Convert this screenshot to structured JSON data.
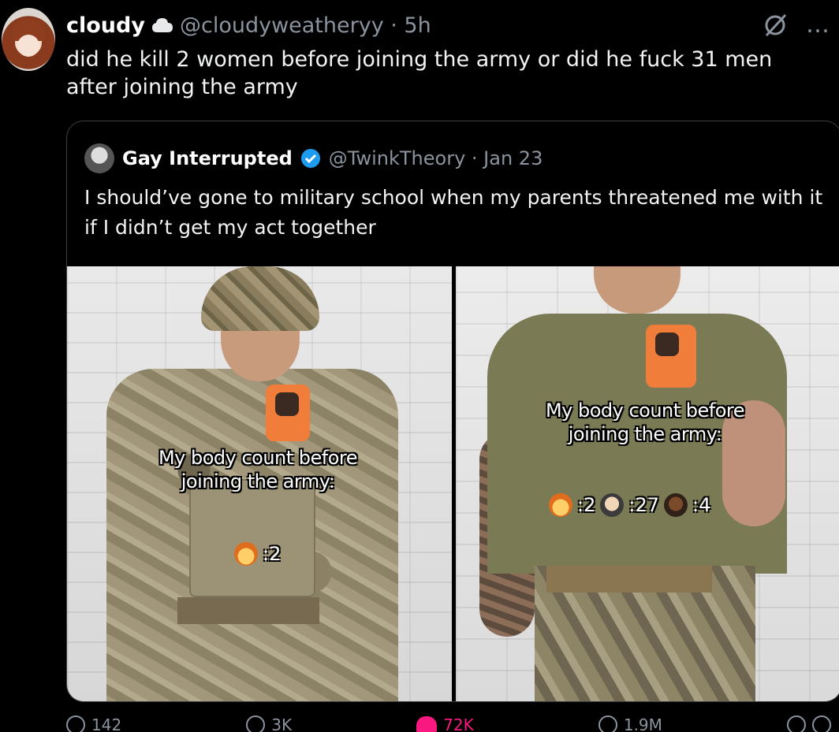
{
  "tweet": {
    "author_name": "cloudy",
    "handle_time": "@cloudyweatheryy · 5h",
    "text": "did he kill 2 women before joining the army or did he fuck 31 men after joining the army",
    "more_icon": "…"
  },
  "quote": {
    "author_name": "Gay Interrupted",
    "handle_time": "@TwinkTheory · Jan 23",
    "text": "I should’ve gone to military school when my parents threatened me with it if I didn’t get my act together",
    "images": [
      {
        "caption": "My body count before joining the army:",
        "counts": [
          {
            "icon": "woman-icon",
            "value": ":2"
          }
        ]
      },
      {
        "caption": "My body count before joining the army:",
        "counts": [
          {
            "icon": "woman-icon",
            "value": ":2"
          },
          {
            "icon": "man-beard-icon",
            "value": ":27"
          },
          {
            "icon": "man-dark-icon",
            "value": ":4"
          }
        ]
      }
    ]
  },
  "actions": {
    "replies": "142",
    "retweets": "3K",
    "likes": "72K",
    "views": "1.9M"
  },
  "colors": {
    "background": "#000000",
    "text": "#e7e9ea",
    "secondary": "#8b949e",
    "verified": "#1d9bf0",
    "like": "#f91880"
  }
}
